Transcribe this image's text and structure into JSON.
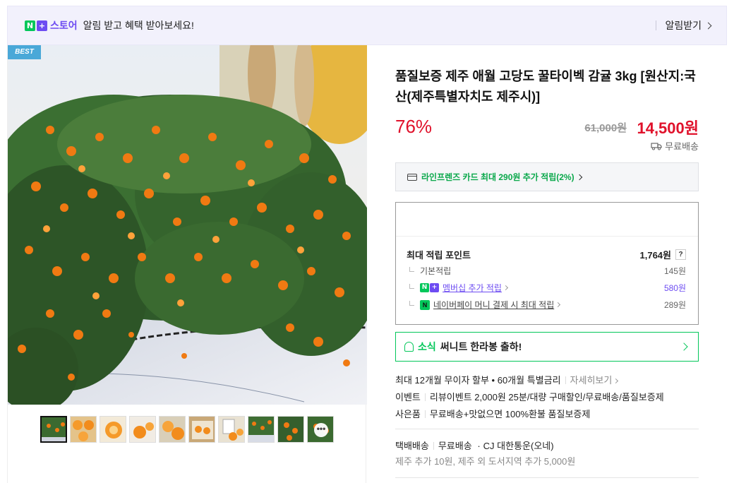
{
  "banner": {
    "logo_n": "N",
    "logo_plus": "+",
    "store_word": "스토어",
    "text": "알림 받고 혜택 받아보세요!",
    "subscribe_label": "알림받기"
  },
  "gallery": {
    "badge": "BEST",
    "more_icon_text": "•••"
  },
  "product": {
    "title": "품질보증 제주 애월 고당도 꿀타이벡 감귤 3kg [원산지:국산(제주특별자치도 제주시)]",
    "discount": "76%",
    "original_price": "61,000원",
    "sale_price": "14,500원",
    "shipping_label": "무료배송"
  },
  "card_benefit": {
    "text": "라인프렌즈 카드 최대 290원 추가 적립(2%)"
  },
  "points": {
    "title": "최대 적립 포인트",
    "total": "1,764원",
    "help": "?",
    "rows": [
      {
        "label": "기본적립",
        "value": "145원"
      },
      {
        "label": "멤버십 추가 적립",
        "value": "580원"
      },
      {
        "label": "네이버페이 머니 결제 시 최대 적립",
        "value": "289원"
      }
    ]
  },
  "news": {
    "label": "소식",
    "text": "써니트 한라봉 출하!"
  },
  "installment": {
    "text": "최대 12개월 무이자 할부 • 60개월 특별금리",
    "link": "자세히보기"
  },
  "event": {
    "label": "이벤트",
    "text": "리뷰이벤트 2,000원 25분/대량 구매할인/무료배송/품질보증제"
  },
  "gift": {
    "label": "사은품",
    "text": "무료배송+맛없으면 100%환불 품질보증제"
  },
  "delivery": {
    "method": "택배배송",
    "fee": "무료배송",
    "dot": "·",
    "carrier": "CJ 대한통운(오네)",
    "extra": "제주 추가 10원, 제주 외 도서지역 추가 5,000원"
  },
  "colors": {
    "accent_green": "#03c75a",
    "price_red": "#e0112b",
    "naver_purple": "#6d4cf2"
  }
}
